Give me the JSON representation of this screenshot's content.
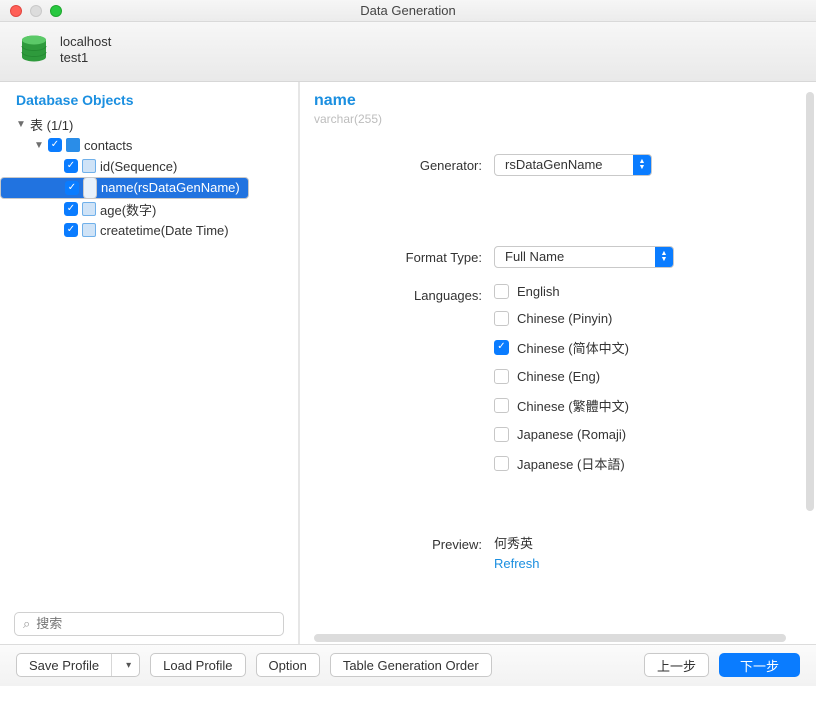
{
  "window": {
    "title": "Data Generation"
  },
  "header": {
    "host": "localhost",
    "database": "test1"
  },
  "sidebar": {
    "title": "Database Objects",
    "root_label": "表 (1/1)",
    "table": "contacts",
    "columns": [
      {
        "label": "id(Sequence)",
        "selected": false
      },
      {
        "label": "name(rsDataGenName)",
        "selected": true
      },
      {
        "label": "age(数字)",
        "selected": false
      },
      {
        "label": "createtime(Date Time)",
        "selected": false
      }
    ],
    "search_placeholder": "搜索"
  },
  "main": {
    "column_name": "name",
    "column_type": "varchar(255)",
    "generator_label": "Generator:",
    "generator_value": "rsDataGenName",
    "format_label": "Format Type:",
    "format_value": "Full Name",
    "languages_label": "Languages:",
    "languages": [
      {
        "label": "English",
        "checked": false
      },
      {
        "label": "Chinese (Pinyin)",
        "checked": false
      },
      {
        "label": "Chinese (简体中文)",
        "checked": true
      },
      {
        "label": "Chinese (Eng)",
        "checked": false
      },
      {
        "label": "Chinese (繁體中文)",
        "checked": false
      },
      {
        "label": "Japanese (Romaji)",
        "checked": false
      },
      {
        "label": "Japanese (日本語)",
        "checked": false
      }
    ],
    "preview_label": "Preview:",
    "preview_value": "何秀英",
    "refresh_label": "Refresh"
  },
  "footer": {
    "save_profile": "Save Profile",
    "load_profile": "Load Profile",
    "option": "Option",
    "table_gen_order": "Table Generation Order",
    "back": "上一步",
    "next": "下一步"
  }
}
